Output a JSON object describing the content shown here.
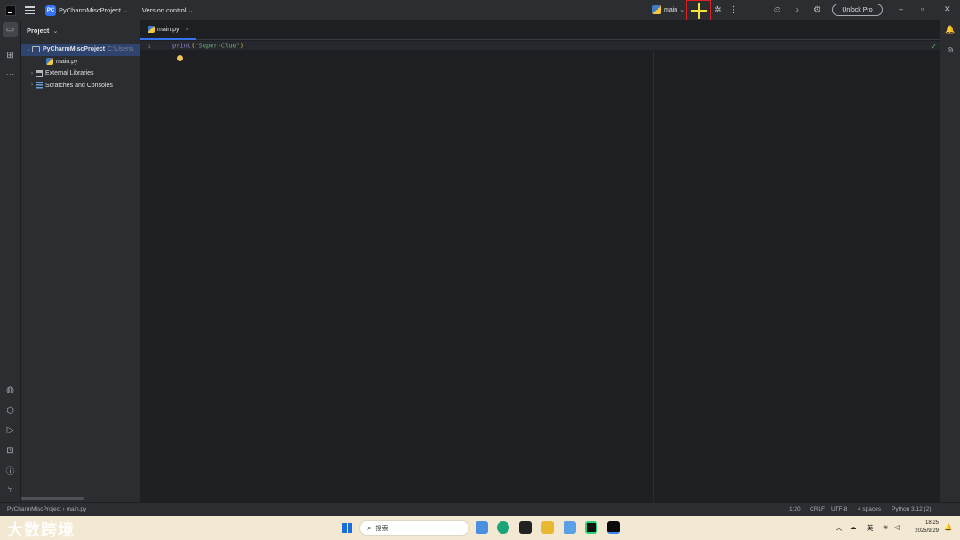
{
  "titlebar": {
    "project_badge": "PC",
    "project_name": "PyCharmMiscProject",
    "version_control": "Version control",
    "run_config": "main",
    "unlock": "Unlock Pro"
  },
  "project_panel": {
    "title": "Project",
    "root": "PyCharmMiscProject",
    "root_path": "C:\\Users\\",
    "items": [
      {
        "label": "main.py"
      },
      {
        "label": "External Libraries"
      },
      {
        "label": "Scratches and Consoles"
      }
    ]
  },
  "editor": {
    "tab": "main.py",
    "line_number": "1",
    "code": {
      "fn": "print",
      "open": "(",
      "str": "\"Super-Clue\"",
      "close": ")"
    }
  },
  "statusbar": {
    "breadcrumb_project": "PyCharmMiscProject",
    "breadcrumb_file": "main.py",
    "position": "1:20",
    "line_sep": "CRLF",
    "encoding": "UTF-8",
    "indent": "4 spaces",
    "interpreter": "Python 3.12 (2)"
  },
  "taskbar": {
    "watermark": "大数跨境",
    "search": "搜索",
    "lang": "英",
    "time": "18:25",
    "date": "2025/9/29"
  },
  "colors": {
    "accent": "#3574f0",
    "highlight_box": "#e02020",
    "plus": "#f5e23a"
  }
}
